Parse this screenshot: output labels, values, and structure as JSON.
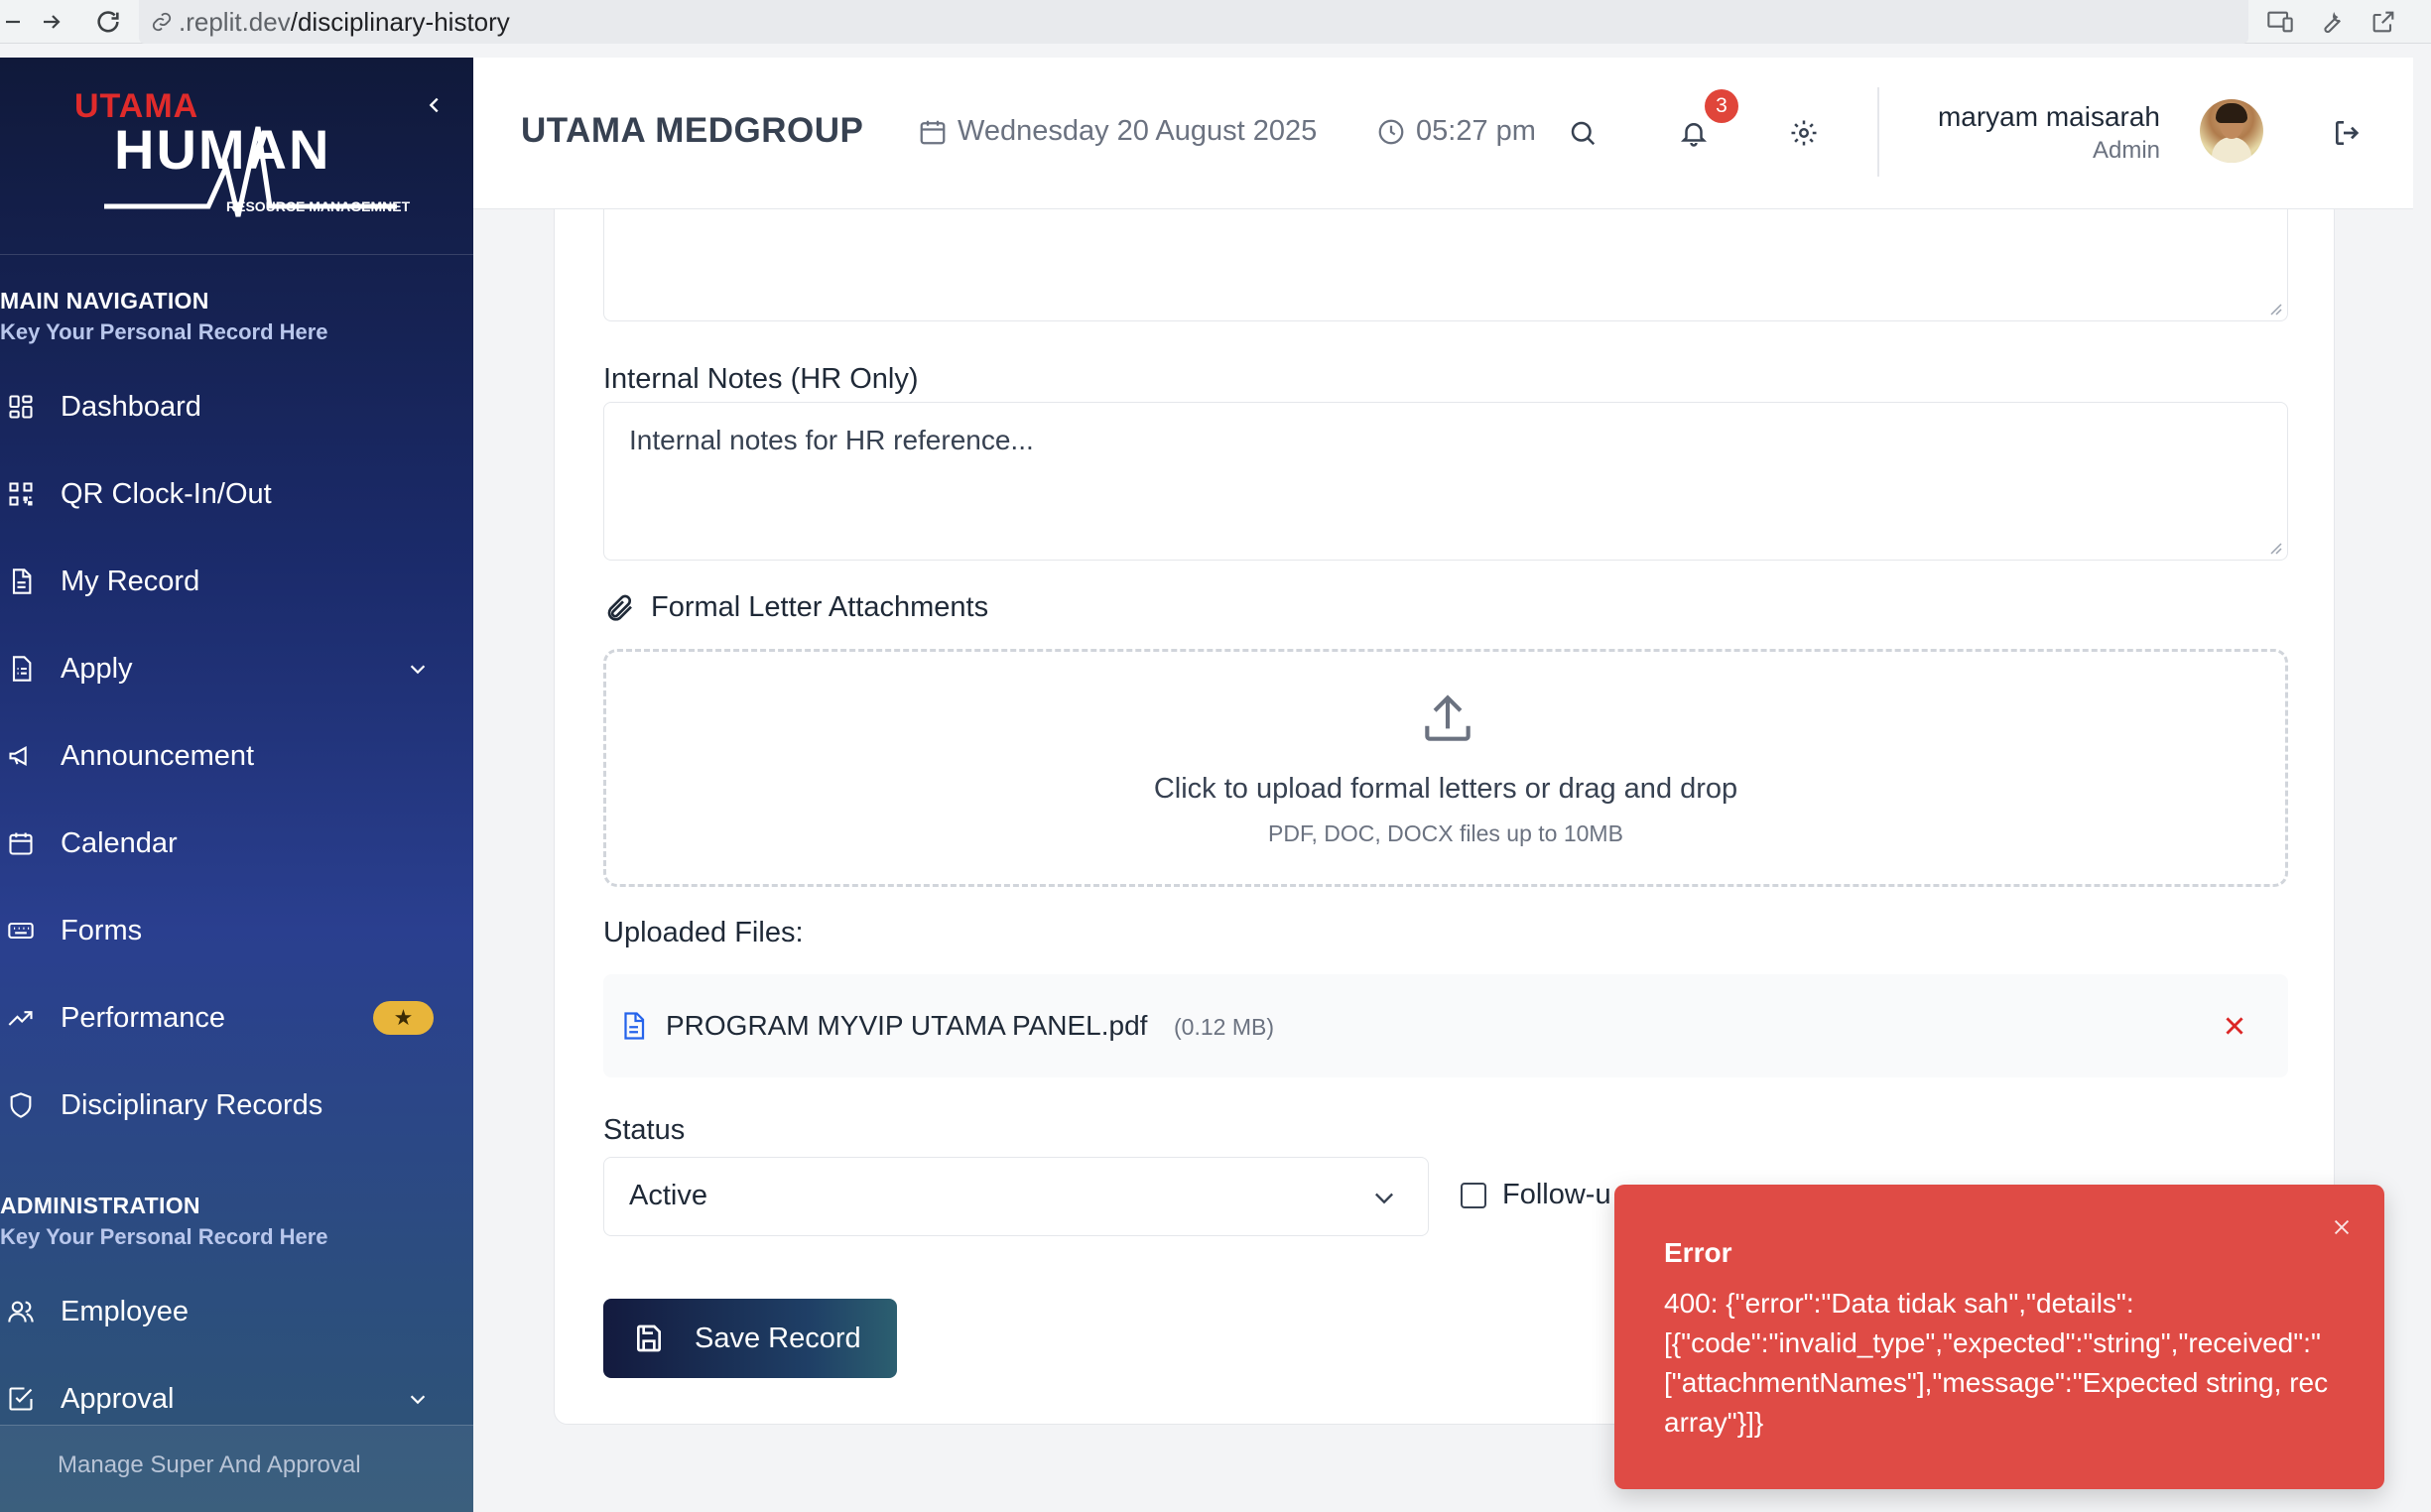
{
  "browser": {
    "url_host": ".replit.dev",
    "url_path": "/disciplinary-history"
  },
  "sidebar": {
    "logo_top": "UTAMA",
    "logo_main": "HUMAN",
    "logo_sub": "RESOURCE MANAGEMNET",
    "main_title": "MAIN NAVIGATION",
    "main_sub": "Key Your Personal Record Here",
    "items": [
      {
        "label": "Dashboard"
      },
      {
        "label": "QR Clock-In/Out"
      },
      {
        "label": "My Record"
      },
      {
        "label": "Apply"
      },
      {
        "label": "Announcement"
      },
      {
        "label": "Calendar"
      },
      {
        "label": "Forms"
      },
      {
        "label": "Performance"
      },
      {
        "label": "Disciplinary Records"
      }
    ],
    "admin_title": "ADMINISTRATION",
    "admin_sub": "Key Your Personal Record Here",
    "admin_items": [
      {
        "label": "Employee"
      },
      {
        "label": "Approval"
      }
    ],
    "footer_label": "Manage Super And Approval"
  },
  "header": {
    "company": "UTAMA MEDGROUP",
    "date": "Wednesday 20 August 2025",
    "time": "05:27 pm",
    "notification_count": "3",
    "user_name": "maryam maisarah",
    "user_role": "Admin"
  },
  "form": {
    "internal_notes_label": "Internal Notes (HR Only)",
    "internal_notes_placeholder": "Internal notes for HR reference...",
    "attachments_label": "Formal Letter Attachments",
    "upload_main": "Click to upload formal letters or drag and drop",
    "upload_sub": "PDF, DOC, DOCX files up to 10MB",
    "uploaded_label": "Uploaded Files:",
    "files": [
      {
        "name": "PROGRAM MYVIP UTAMA PANEL.pdf",
        "size": "(0.12 MB)"
      }
    ],
    "status_label": "Status",
    "status_value": "Active",
    "followup_label": "Follow-u",
    "save_label": "Save Record"
  },
  "toast": {
    "title": "Error",
    "message": "400: {\"error\":\"Data tidak sah\",\"details\":\n[{\"code\":\"invalid_type\",\"expected\":\"string\",\"received\":\"\n[\"attachmentNames\"],\"message\":\"Expected string, rec\narray\"}]}"
  },
  "colors": {
    "sidebar_top": "#10193a",
    "sidebar_bottom": "#2f5575",
    "toast_bg": "#df4b45",
    "badge_red": "#e0453a",
    "star_badge": "#e8b53a"
  }
}
